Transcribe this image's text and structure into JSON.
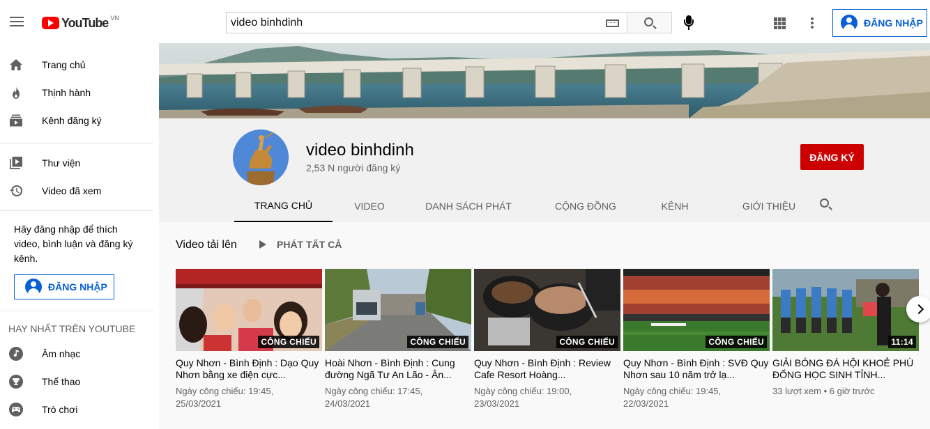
{
  "header": {
    "logo_text": "YouTube",
    "logo_region": "VN",
    "search_value": "video binhdinh",
    "signin_label": "ĐĂNG NHẬP"
  },
  "sidebar": {
    "items": [
      {
        "label": "Trang chủ",
        "icon": "home-icon"
      },
      {
        "label": "Thịnh hành",
        "icon": "fire-icon"
      },
      {
        "label": "Kênh đăng ký",
        "icon": "subscriptions-icon"
      },
      {
        "label": "Thư viện",
        "icon": "library-icon"
      },
      {
        "label": "Video đã xem",
        "icon": "history-icon"
      }
    ],
    "signin_note": "Hãy đăng nhập để thích video, bình luận và đăng ký kênh.",
    "signin_label": "ĐĂNG NHẬP",
    "best_heading": "HAY NHẤT TRÊN YOUTUBE",
    "best_items": [
      {
        "label": "Âm nhạc",
        "icon": "music-icon"
      },
      {
        "label": "Thể thao",
        "icon": "trophy-icon"
      },
      {
        "label": "Trò chơi",
        "icon": "game-icon"
      }
    ]
  },
  "channel": {
    "name": "video binhdinh",
    "subscribers": "2,53 N người đăng ký",
    "subscribe_label": "ĐĂNG KÝ",
    "tabs": [
      "TRANG CHỦ",
      "VIDEO",
      "DANH SÁCH PHÁT",
      "CỘNG ĐỒNG",
      "KÊNH",
      "GIỚI THIỆU"
    ],
    "active_tab": "TRANG CHỦ"
  },
  "section": {
    "title": "Video tải lên",
    "play_all": "PHÁT TẤT CẢ"
  },
  "videos": [
    {
      "title": "Quy Nhơn - Bình Định : Dạo Quy Nhơn bằng xe điện cực...",
      "badge": "CÔNG CHIẾU",
      "meta1": "Ngày công chiếu: 19:45,",
      "meta2": "25/03/2021"
    },
    {
      "title": "Hoài Nhơn - Bình Định : Cung đường Ngã Tư An Lão - Ân...",
      "badge": "CÔNG CHIẾU",
      "meta1": "Ngày công chiếu: 17:45,",
      "meta2": "24/03/2021"
    },
    {
      "title": "Quy Nhơn - Bình Định : Review Cafe Resort Hoàng...",
      "badge": "CÔNG CHIẾU",
      "meta1": "Ngày công chiếu: 19:00,",
      "meta2": "23/03/2021"
    },
    {
      "title": "Quy Nhơn - Bình Định : SVĐ Quy Nhơn sau 10 năm trở lạ...",
      "badge": "CÔNG CHIẾU",
      "meta1": "Ngày công chiếu: 19:45,",
      "meta2": "22/03/2021"
    },
    {
      "title": "GIẢI BÓNG ĐÁ HỘI KHOẺ PHÙ ĐỔNG HỌC SINH TỈNH...",
      "badge": "11:14",
      "meta1": "33 lượt xem • 6 giờ trước",
      "meta2": ""
    }
  ],
  "colors": {
    "brand_red": "#ff0000",
    "subscribe_red": "#cc0000",
    "link_blue": "#065fd4"
  }
}
